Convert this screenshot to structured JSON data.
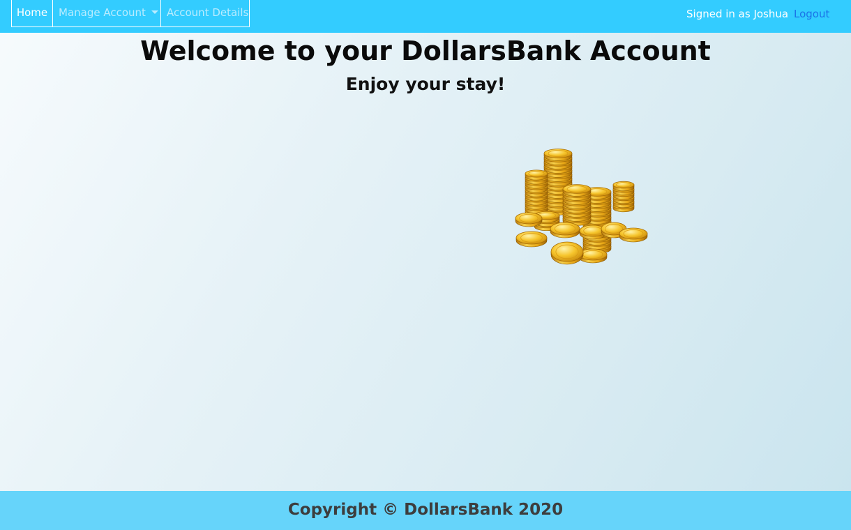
{
  "nav": {
    "home_label": "Home",
    "manage_label": "Manage Account",
    "details_label": "Account Details",
    "signed_in_text": "Signed in as Joshua",
    "logout_label": "Logout"
  },
  "main": {
    "title": "Welcome to your DollarsBank Account",
    "subtitle": "Enjoy your stay!",
    "image_icon": "gold-coins-icon"
  },
  "footer": {
    "copyright": "Copyright © DollarsBank 2020"
  },
  "colors": {
    "navbar": "#33ccff",
    "footer": "#66d4fa",
    "logout_link": "#1a73e8",
    "coin_gold": "#f2b518"
  }
}
